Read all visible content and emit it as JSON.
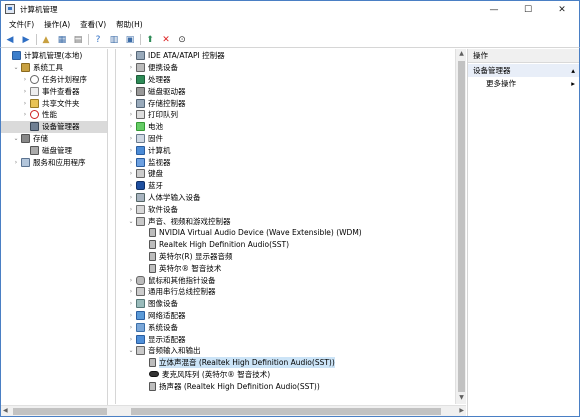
{
  "window": {
    "title": "计算机管理",
    "controls": [
      "—",
      "☐",
      "✕"
    ]
  },
  "menu": [
    "文件(F)",
    "操作(A)",
    "查看(V)",
    "帮助(H)"
  ],
  "toolbar": [
    {
      "icon": "back-icon",
      "glyph": "◀",
      "color": "#2f6fc4"
    },
    {
      "icon": "forward-icon",
      "glyph": "▶",
      "color": "#2f6fc4"
    },
    {
      "icon": "up-folder-icon",
      "glyph": "▲",
      "color": "#c8a040"
    },
    {
      "icon": "show-tree-icon",
      "glyph": "▦",
      "color": "#3d6da8"
    },
    {
      "icon": "properties-icon",
      "glyph": "▤",
      "color": "#6b6b6b"
    },
    {
      "icon": "help-icon",
      "glyph": "?",
      "color": "#2f6fc4"
    },
    {
      "icon": "view-icon",
      "glyph": "▥",
      "color": "#3d6da8"
    },
    {
      "icon": "monitor-icon",
      "glyph": "▣",
      "color": "#3d6da8"
    },
    {
      "icon": "update-driver-icon",
      "glyph": "⬆",
      "color": "#2e8b57"
    },
    {
      "icon": "delete-icon",
      "glyph": "✕",
      "color": "#d22"
    },
    {
      "icon": "download-icon",
      "glyph": "⊙",
      "color": "#333"
    }
  ],
  "left_tree": [
    {
      "label": "计算机管理(本地)",
      "exp": "",
      "indent": 0,
      "icon": "i-computer",
      "name": "computer-management-root"
    },
    {
      "label": "系统工具",
      "exp": "⌄",
      "indent": 1,
      "icon": "i-tools",
      "name": "system-tools"
    },
    {
      "label": "任务计划程序",
      "exp": "›",
      "indent": 2,
      "icon": "i-clock",
      "name": "task-scheduler"
    },
    {
      "label": "事件查看器",
      "exp": "›",
      "indent": 2,
      "icon": "i-log",
      "name": "event-viewer"
    },
    {
      "label": "共享文件夹",
      "exp": "›",
      "indent": 2,
      "icon": "i-share",
      "name": "shared-folders"
    },
    {
      "label": "性能",
      "exp": "›",
      "indent": 2,
      "icon": "i-perf",
      "name": "performance"
    },
    {
      "label": "设备管理器",
      "exp": "",
      "indent": 2,
      "icon": "i-dev",
      "name": "device-manager",
      "selected": true
    },
    {
      "label": "存储",
      "exp": "⌄",
      "indent": 1,
      "icon": "i-store",
      "name": "storage"
    },
    {
      "label": "磁盘管理",
      "exp": "",
      "indent": 2,
      "icon": "i-disk",
      "name": "disk-management"
    },
    {
      "label": "服务和应用程序",
      "exp": "›",
      "indent": 1,
      "icon": "i-svc",
      "name": "services-and-apps"
    }
  ],
  "device_tree": [
    {
      "label": "IDE ATA/ATAPI 控制器",
      "exp": "›",
      "indent": 0,
      "icon": "i-ctrl"
    },
    {
      "label": "便携设备",
      "exp": "›",
      "indent": 0,
      "icon": "i-drive"
    },
    {
      "label": "处理器",
      "exp": "›",
      "indent": 0,
      "icon": "i-cpu"
    },
    {
      "label": "磁盘驱动器",
      "exp": "›",
      "indent": 0,
      "icon": "i-hdd"
    },
    {
      "label": "存储控制器",
      "exp": "›",
      "indent": 0,
      "icon": "i-ctrl"
    },
    {
      "label": "打印队列",
      "exp": "›",
      "indent": 0,
      "icon": "i-print"
    },
    {
      "label": "电池",
      "exp": "›",
      "indent": 0,
      "icon": "i-batt"
    },
    {
      "label": "固件",
      "exp": "›",
      "indent": 0,
      "icon": "i-firm"
    },
    {
      "label": "计算机",
      "exp": "›",
      "indent": 0,
      "icon": "i-pc"
    },
    {
      "label": "监视器",
      "exp": "›",
      "indent": 0,
      "icon": "i-mon"
    },
    {
      "label": "键盘",
      "exp": "›",
      "indent": 0,
      "icon": "i-kbd"
    },
    {
      "label": "蓝牙",
      "exp": "›",
      "indent": 0,
      "icon": "i-bt"
    },
    {
      "label": "人体学输入设备",
      "exp": "›",
      "indent": 0,
      "icon": "i-hid"
    },
    {
      "label": "软件设备",
      "exp": "›",
      "indent": 0,
      "icon": "i-sw"
    },
    {
      "label": "声音、视频和游戏控制器",
      "exp": "⌄",
      "indent": 0,
      "icon": "i-snd"
    },
    {
      "label": "NVIDIA Virtual Audio Device (Wave Extensible) (WDM)",
      "exp": "",
      "indent": 1,
      "icon": "i-spk"
    },
    {
      "label": "Realtek High Definition Audio(SST)",
      "exp": "",
      "indent": 1,
      "icon": "i-spk"
    },
    {
      "label": "英特尔(R) 显示器音频",
      "exp": "",
      "indent": 1,
      "icon": "i-spk"
    },
    {
      "label": "英特尔® 智音技术",
      "exp": "",
      "indent": 1,
      "icon": "i-spk"
    },
    {
      "label": "鼠标和其他指针设备",
      "exp": "›",
      "indent": 0,
      "icon": "i-mouse"
    },
    {
      "label": "通用串行总线控制器",
      "exp": "›",
      "indent": 0,
      "icon": "i-usb"
    },
    {
      "label": "图像设备",
      "exp": "›",
      "indent": 0,
      "icon": "i-img"
    },
    {
      "label": "网络适配器",
      "exp": "›",
      "indent": 0,
      "icon": "i-net"
    },
    {
      "label": "系统设备",
      "exp": "›",
      "indent": 0,
      "icon": "i-sys"
    },
    {
      "label": "显示适配器",
      "exp": "›",
      "indent": 0,
      "icon": "i-disp"
    },
    {
      "label": "音频输入和输出",
      "exp": "⌄",
      "indent": 0,
      "icon": "i-snd"
    },
    {
      "label": "立体声混音 (Realtek High Definition Audio(SST))",
      "exp": "",
      "indent": 1,
      "icon": "i-spk",
      "selected": true
    },
    {
      "label": "麦克风阵列 (英特尔® 智音技术)",
      "exp": "",
      "indent": 1,
      "icon": "i-mic"
    },
    {
      "label": "扬声器 (Realtek High Definition Audio(SST))",
      "exp": "",
      "indent": 1,
      "icon": "i-spk"
    }
  ],
  "actions": {
    "header": "操作",
    "section": "设备管理器",
    "section_arrow": "▴",
    "more": "更多操作",
    "more_arrow": "▸"
  }
}
